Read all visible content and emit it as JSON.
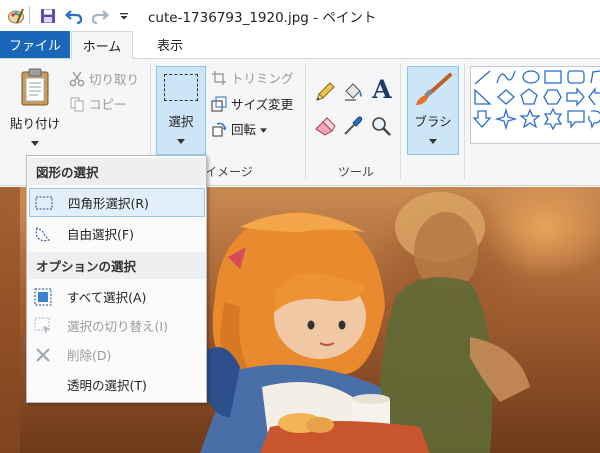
{
  "window": {
    "title": "cute-1736793_1920.jpg - ペイント"
  },
  "quick_access": {
    "icons": [
      "paint-app-icon",
      "save-icon",
      "undo-icon",
      "redo-icon",
      "customize-dropdown-icon"
    ]
  },
  "tabs": [
    {
      "label": "ファイル",
      "active": false
    },
    {
      "label": "ホーム",
      "active": true
    },
    {
      "label": "表示",
      "active": false
    }
  ],
  "ribbon": {
    "clipboard": {
      "paste_label": "貼り付け",
      "cut_label": "切り取り",
      "copy_label": "コピー"
    },
    "image": {
      "group_label": "イメージ",
      "select_label": "選択",
      "crop_label": "トリミング",
      "resize_label": "サイズ変更",
      "rotate_label": "回転"
    },
    "tools": {
      "group_label": "ツール",
      "icons": [
        "pencil-icon",
        "fill-bucket-icon",
        "text-icon",
        "eraser-icon",
        "color-picker-icon",
        "magnifier-icon"
      ],
      "text_glyph": "A"
    },
    "brushes": {
      "label": "ブラシ"
    },
    "shapes": {
      "icons": [
        "line-icon",
        "curve-icon",
        "oval-icon",
        "rectangle-icon",
        "rounded-rectangle-icon",
        "polygon-icon",
        "right-triangle-icon",
        "diamond-icon",
        "pentagon-icon",
        "hexagon-icon",
        "right-arrow-icon",
        "left-arrow-icon",
        "down-arrow-icon",
        "four-point-star-icon",
        "five-point-star-icon",
        "six-point-star-icon",
        "speech-bubble-icon",
        "rounded-callout-icon"
      ]
    }
  },
  "select_menu": {
    "section_shape": "図形の選択",
    "items_shape": [
      {
        "label": "四角形選択(R)",
        "highlighted": true,
        "disabled": false
      },
      {
        "label": "自由選択(F)",
        "highlighted": false,
        "disabled": false
      }
    ],
    "section_options": "オプションの選択",
    "items_options": [
      {
        "label": "すべて選択(A)",
        "disabled": false
      },
      {
        "label": "選択の切り替え(I)",
        "disabled": true
      },
      {
        "label": "削除(D)",
        "disabled": true
      },
      {
        "label": "透明の選択(T)",
        "disabled": false
      }
    ]
  },
  "colors": {
    "file_tab": "#1a66b8",
    "selected_button": "#cde6f7",
    "ribbon_bg": "#f5f6f7",
    "menu_highlight": "#e2effa"
  }
}
